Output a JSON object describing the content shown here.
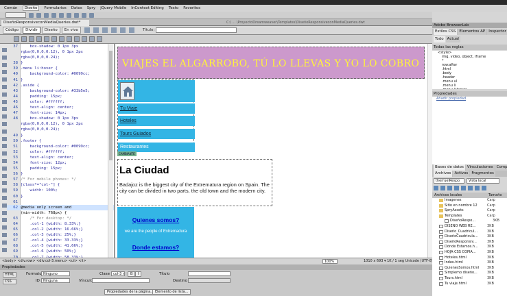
{
  "menu": {
    "items": [
      "Común",
      "Diseño",
      "Formularios",
      "Datos",
      "Spry",
      "jQuery Mobile",
      "InContext Editing",
      "Texto",
      "Favoritos"
    ],
    "active_index": 1
  },
  "insertbar": {
    "selector": "Estándar"
  },
  "document": {
    "tab": "DiseñoResponsiveconMediaQueries.dwt*",
    "path": "C:\\ ... \\ProyectoDreamweaver\\Templates\\DiseñoResponsiveconMediaQueries.dwt"
  },
  "viewbar": {
    "buttons": [
      "Código",
      "Dividir",
      "Diseño",
      "En vivo"
    ],
    "active_index": 1,
    "title_label": "Título:"
  },
  "code": {
    "lines": [
      {
        "n": "37",
        "t": "    box-shadow: 0 1px 3px"
      },
      {
        "n": "",
        "t": "rgba(0,0,0,0.12), 0 1px 2px"
      },
      {
        "n": "",
        "t": "rgba(0,0,0,0.24);"
      },
      {
        "n": "38",
        "t": "}"
      },
      {
        "n": "39",
        "t": ".menu li:hover {"
      },
      {
        "n": "40",
        "t": "    background-color: #0099cc;"
      },
      {
        "n": "41",
        "t": "}"
      },
      {
        "n": "42",
        "t": ".aside {"
      },
      {
        "n": "43",
        "t": "    background-color: #33b5e5;"
      },
      {
        "n": "44",
        "t": "    padding: 15px;"
      },
      {
        "n": "45",
        "t": "    color: #ffffff;"
      },
      {
        "n": "46",
        "t": "    text-align: center;"
      },
      {
        "n": "47",
        "t": "    font-size: 14px;"
      },
      {
        "n": "48",
        "t": "    box-shadow: 0 1px 3px"
      },
      {
        "n": "",
        "t": "rgba(0,0,0,0.12), 0 1px 2px"
      },
      {
        "n": "",
        "t": "rgba(0,0,0,0.24);"
      },
      {
        "n": "49",
        "t": "}"
      },
      {
        "n": "50",
        "t": ".footer {"
      },
      {
        "n": "51",
        "t": "    background-color: #0099cc;"
      },
      {
        "n": "52",
        "t": "    color: #ffffff;"
      },
      {
        "n": "53",
        "t": "    text-align: center;"
      },
      {
        "n": "54",
        "t": "    font-size: 12px;"
      },
      {
        "n": "55",
        "t": "    padding: 15px;"
      },
      {
        "n": "56",
        "t": "}"
      },
      {
        "n": "57",
        "t": "/* For mobile phones: */"
      },
      {
        "n": "58",
        "t": "[class*=\"col-\"] {"
      },
      {
        "n": "59",
        "t": "    width: 100%;"
      },
      {
        "n": "60",
        "t": "}"
      },
      {
        "n": "61",
        "t": ""
      },
      {
        "n": "62",
        "t": "@media only screen and"
      },
      {
        "n": "",
        "t": "(min-width: 768px) {"
      },
      {
        "n": "63",
        "t": "    /* For desktop: */"
      },
      {
        "n": "64",
        "t": "    .col-1 {width: 8.33%;}"
      },
      {
        "n": "65",
        "t": "    .col-2 {width: 16.66%;}"
      },
      {
        "n": "66",
        "t": "    .col-3 {width: 25%;}"
      },
      {
        "n": "67",
        "t": "    .col-4 {width: 33.33%;}"
      },
      {
        "n": "68",
        "t": "    .col-5 {width: 41.66%;}"
      },
      {
        "n": "69",
        "t": "    .col-6 {width: 50%;}"
      },
      {
        "n": "70",
        "t": "    .col-7 {width: 58.33%;}"
      },
      {
        "n": "71",
        "t": "    .col-8 {width: 66.66%;}"
      },
      {
        "n": "72",
        "t": "    .col-9 {width: 75%;}"
      }
    ],
    "highlight_line": "62"
  },
  "design": {
    "header": "VIAJES EL ALGARROBO, TÚ LO LLEVAS Y YO LO COBRO",
    "nav": [
      "Tu Viaje",
      "Hoteles",
      "Tours Guiados"
    ],
    "nav_last": "Restaurantes",
    "badge": "CAMBIANTE",
    "main_title": "La Ciudad",
    "main_text": "Badajoz is the biggest city of the Extrematura region on Spain. The city can be divided in two parts, the old town and the modern city.",
    "aside_q1": "Quienes somos?",
    "aside_sub": "we are the people of Extremadura",
    "aside_q2": "Donde estamos?"
  },
  "status": {
    "tags": "<body> <div.row> <div.col-3.menu> <ul> <li>",
    "zoom": "100%",
    "dims": "1010 x 693 ▾  1K / 1 seg  Unicode (UTF-8)"
  },
  "properties": {
    "title": "Propiedades",
    "html": "HTML",
    "css": "CSS",
    "format_label": "Formato",
    "format_value": "Ninguno",
    "class_label": "Clase",
    "class_value": "col-3 menu",
    "id_label": "ID",
    "id_value": "Ninguna",
    "link_label": "Vínculo",
    "target_label": "Destino",
    "title_label": "Título",
    "page_props": "Propiedades de la página...",
    "list_item": "Elemento de lista..."
  },
  "right": {
    "bl_title": "Adobe BrowserLab",
    "css_tabs": [
      "Estilos CSS",
      "Elementos AP",
      "Inspector de"
    ],
    "mode_tabs": [
      "Todo",
      "Actual"
    ],
    "rules_title": "Todas las reglas",
    "rules": [
      "<style>",
      "img, video, object, iframe",
      "*",
      "row:after",
      ".html",
      ".body",
      ".header",
      ".menu ul",
      ".menu li",
      ".menu li:hover"
    ],
    "props_title": "Propiedades",
    "add_prop": "Añadir propiedad",
    "db_tabs": [
      "Bases de datos",
      "Vinculaciones",
      "Comportam"
    ],
    "files_tabs": [
      "Archivos",
      "Activos",
      "Fragmentos"
    ],
    "site": "therruelRespo",
    "view": "Vista local",
    "local_title": "Archivos locales",
    "size_title": "Tamaño",
    "files": [
      {
        "n": "Imagenes",
        "s": "Carp",
        "k": "fold"
      },
      {
        "n": "Sitio en nombre 12",
        "s": "Carp",
        "k": "fold"
      },
      {
        "n": "SpryAssets",
        "s": "Carp",
        "k": "fold"
      },
      {
        "n": "Templates",
        "s": "Carp",
        "k": "fold"
      },
      {
        "n": "DiseñoRespo...",
        "s": "3KB",
        "k": "file"
      },
      {
        "n": "DISEÑO WEB RE...",
        "s": "3KB",
        "k": "file"
      },
      {
        "n": "Diseño_Cuadricul...",
        "s": "3KB",
        "k": "file"
      },
      {
        "n": "DiseñoCuadricula...",
        "s": "3KB",
        "k": "file"
      },
      {
        "n": "DiseñoResponsiv...",
        "s": "3KB",
        "k": "file"
      },
      {
        "n": "Dónde Estamos.h...",
        "s": "3KB",
        "k": "file"
      },
      {
        "n": "HOJA CSS COPIA...",
        "s": "3KB",
        "k": "file"
      },
      {
        "n": "Hoteles.html",
        "s": "3KB",
        "k": "file"
      },
      {
        "n": "Index.html",
        "s": "3KB",
        "k": "file"
      },
      {
        "n": "QuienesSomos.html",
        "s": "3KB",
        "k": "file"
      },
      {
        "n": "Simplemo diseño...",
        "s": "3KB",
        "k": "file"
      },
      {
        "n": "Tours.html",
        "s": "3KB",
        "k": "file"
      },
      {
        "n": "Tu viaje.html",
        "s": "3KB",
        "k": "file"
      }
    ]
  }
}
